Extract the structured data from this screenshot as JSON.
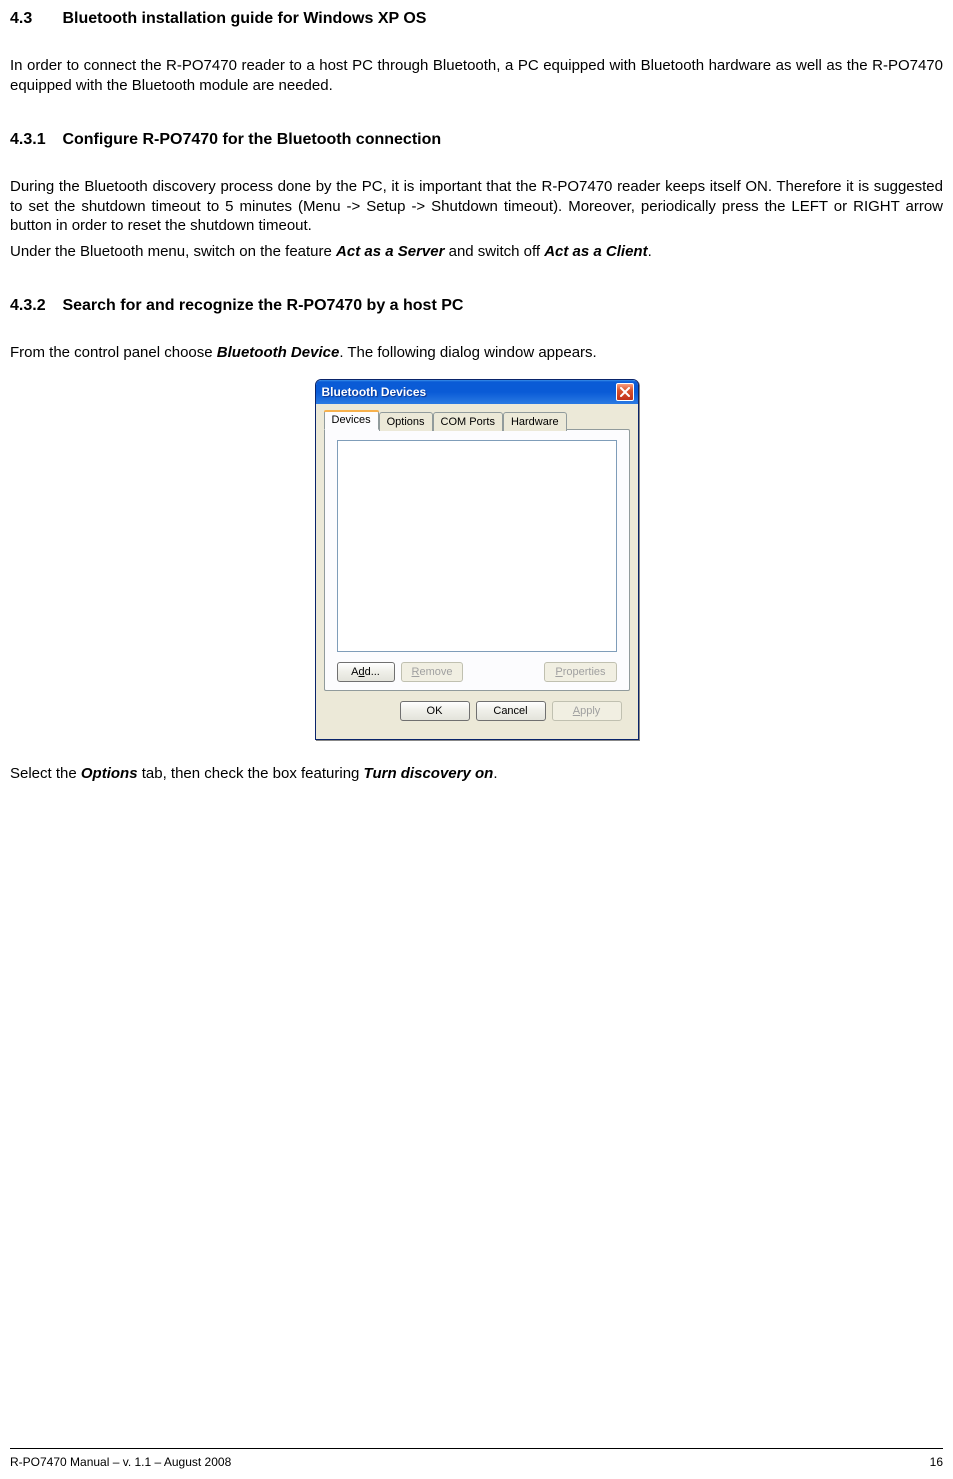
{
  "section": {
    "num": "4.3",
    "title": "Bluetooth installation guide for Windows XP OS",
    "intro": "In order to connect the R-PO7470 reader to a host PC through Bluetooth, a PC equipped with Bluetooth hardware as well as the R-PO7470 equipped with the Bluetooth module are needed."
  },
  "sub1": {
    "num": "4.3.1",
    "title": "Configure R-PO7470 for the Bluetooth connection",
    "p1": "During the Bluetooth discovery process done by the PC, it is important that the R-PO7470 reader keeps itself ON. Therefore it is suggested to set the shutdown timeout to 5 minutes (Menu -> Setup -> Shutdown timeout). Moreover, periodically press the LEFT or RIGHT arrow button in order to reset the shutdown timeout.",
    "p2a": "Under the Bluetooth menu, switch on the feature ",
    "p2b": "Act as a Server",
    "p2c": " and switch off ",
    "p2d": "Act as a Client",
    "p2e": "."
  },
  "sub2": {
    "num": "4.3.2",
    "title": "Search for and recognize the R-PO7470 by a host PC",
    "p1a": "From the control panel choose ",
    "p1b": "Bluetooth Device",
    "p1c": ". The following dialog window appears.",
    "p2a": "Select the ",
    "p2b": "Options",
    "p2c": " tab, then check the box featuring ",
    "p2d": "Turn discovery on",
    "p2e": "."
  },
  "dialog": {
    "title": "Bluetooth Devices",
    "tabs": {
      "devices": "Devices",
      "options": "Options",
      "comports": "COM Ports",
      "hardware": "Hardware"
    },
    "buttons": {
      "add": {
        "pre": "A",
        "u": "d",
        "post": "d..."
      },
      "remove": {
        "u": "R",
        "post": "emove"
      },
      "properties": {
        "u": "P",
        "post": "roperties"
      },
      "ok": "OK",
      "cancel": "Cancel",
      "apply": {
        "u": "A",
        "post": "pply"
      }
    }
  },
  "footer": {
    "left": "R-PO7470 Manual – v. 1.1 – August 2008",
    "right": "16"
  }
}
